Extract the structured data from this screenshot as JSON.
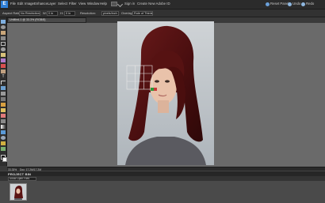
{
  "app": {
    "logo": "E"
  },
  "menu": {
    "items": [
      "File",
      "Edit",
      "Image",
      "Enhance",
      "Layer",
      "Select",
      "Filter",
      "View",
      "Window",
      "Help"
    ],
    "sign_in": "Sign in",
    "create_account": "Create New Adobe ID",
    "reset_panels": "Reset Panels",
    "undo": "Undo",
    "redo": "Redo"
  },
  "options": {
    "aspect_ratio_label": "Aspect Ratio:",
    "aspect_ratio_value": "No Restriction",
    "width_label": "W:",
    "width_value": "0 in",
    "height_label": "H:",
    "height_value": "0 in",
    "resolution_label": "Resolution:",
    "resolution_value": "pixels/inch",
    "overlay_label": "Overlay:",
    "overlay_value": "Rule of Thirds"
  },
  "document": {
    "tab_title": "Untitled-1 @ 33.3% (RGB/8)",
    "zoom": "33.33%",
    "size_info": "Doc: 17.2M/17.2M"
  },
  "project_bin": {
    "title": "PROJECT BIN",
    "show_label": "Show Open Files"
  },
  "colors": {
    "menubar": "#2b2b2b",
    "canvas_bg": "#6a6a6a",
    "accent_blue": "#2f7fd6",
    "hair": "#5a1414"
  },
  "icons": [
    "move-tool-icon",
    "zoom-tool-icon",
    "hand-tool-icon",
    "eyedropper-tool-icon",
    "marquee-tool-icon",
    "lasso-tool-icon",
    "magic-wand-tool-icon",
    "quick-selection-tool-icon",
    "red-eye-tool-icon",
    "spot-healing-tool-icon",
    "type-tool-icon",
    "crop-tool-icon",
    "recompose-tool-icon",
    "cookie-cutter-tool-icon",
    "straighten-tool-icon",
    "brush-tool-icon",
    "pencil-tool-icon",
    "eraser-tool-icon",
    "paint-bucket-tool-icon",
    "gradient-tool-icon",
    "shape-tool-icon",
    "blur-tool-icon",
    "sponge-tool-icon",
    "clone-stamp-tool-icon",
    "foreground-color-swatch",
    "background-color-swatch"
  ]
}
